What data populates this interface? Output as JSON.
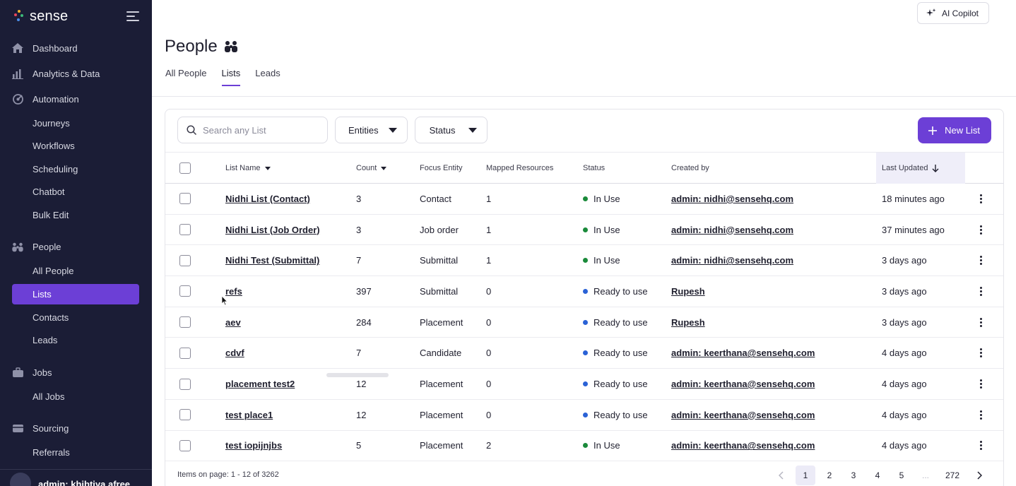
{
  "app": {
    "brand": "sense",
    "accent": "#6c3fd6",
    "sidebar_bg": "#1b1d36"
  },
  "sidebar": {
    "groups": [
      {
        "label": "Dashboard",
        "icon": "home-icon"
      },
      {
        "label": "Analytics & Data",
        "icon": "bar-chart-icon"
      },
      {
        "label": "Automation",
        "icon": "automation-icon",
        "items": [
          "Journeys",
          "Workflows",
          "Scheduling",
          "Chatbot",
          "Bulk Edit"
        ]
      },
      {
        "label": "People",
        "icon": "people-icon",
        "items": [
          "All People",
          "Lists",
          "Contacts",
          "Leads"
        ]
      },
      {
        "label": "Jobs",
        "icon": "briefcase-icon",
        "items": [
          "All Jobs"
        ]
      },
      {
        "label": "Sourcing",
        "icon": "sourcing-icon",
        "items": [
          "Referrals"
        ]
      }
    ],
    "user": "admin: khibtiya.afree"
  },
  "header": {
    "copilot_label": "AI Copilot",
    "title": "People",
    "tabs": [
      "All People",
      "Lists",
      "Leads"
    ],
    "active_tab": "Lists"
  },
  "toolbar": {
    "search_placeholder": "Search any List",
    "entities_label": "Entities",
    "status_label": "Status",
    "new_list_label": "New List"
  },
  "table": {
    "columns": [
      "List Name",
      "Count",
      "Focus Entity",
      "Mapped Resources",
      "Status",
      "Created by",
      "Last Updated"
    ],
    "sorted_column": "Last Updated",
    "rows": [
      {
        "name": "Nidhi List (Contact)",
        "count": "3",
        "entity": "Contact",
        "mapped": "1",
        "status": "In Use",
        "status_color": "#1a8a3a",
        "created_by": "admin: nidhi@sensehq.com",
        "updated": "18 minutes ago"
      },
      {
        "name": "Nidhi List (Job Order)",
        "count": "3",
        "entity": "Job order",
        "mapped": "1",
        "status": "In Use",
        "status_color": "#1a8a3a",
        "created_by": "admin: nidhi@sensehq.com",
        "updated": "37 minutes ago"
      },
      {
        "name": "Nidhi Test (Submittal)",
        "count": "7",
        "entity": "Submittal",
        "mapped": "1",
        "status": "In Use",
        "status_color": "#1a8a3a",
        "created_by": "admin: nidhi@sensehq.com",
        "updated": "3 days ago"
      },
      {
        "name": "refs",
        "count": "397",
        "entity": "Submittal",
        "mapped": "0",
        "status": "Ready to use",
        "status_color": "#2a62d6",
        "created_by": "Rupesh",
        "updated": "3 days ago"
      },
      {
        "name": "aev",
        "count": "284",
        "entity": "Placement",
        "mapped": "0",
        "status": "Ready to use",
        "status_color": "#2a62d6",
        "created_by": "Rupesh",
        "updated": "3 days ago"
      },
      {
        "name": "cdvf",
        "count": "7",
        "entity": "Candidate",
        "mapped": "0",
        "status": "Ready to use",
        "status_color": "#2a62d6",
        "created_by": "admin: keerthana@sensehq.com",
        "updated": "4 days ago"
      },
      {
        "name": "placement test2",
        "count": "12",
        "entity": "Placement",
        "mapped": "0",
        "status": "Ready to use",
        "status_color": "#2a62d6",
        "created_by": "admin: keerthana@sensehq.com",
        "updated": "4 days ago"
      },
      {
        "name": "test place1",
        "count": "12",
        "entity": "Placement",
        "mapped": "0",
        "status": "Ready to use",
        "status_color": "#2a62d6",
        "created_by": "admin: keerthana@sensehq.com",
        "updated": "4 days ago"
      },
      {
        "name": "test iopijnjbs",
        "count": "5",
        "entity": "Placement",
        "mapped": "2",
        "status": "In Use",
        "status_color": "#1a8a3a",
        "created_by": "admin: keerthana@sensehq.com",
        "updated": "4 days ago"
      }
    ]
  },
  "footer": {
    "items_text": "Items on page: 1 - 12 of 3262",
    "pages": [
      "1",
      "2",
      "3",
      "4",
      "5",
      "...",
      "272"
    ],
    "current_page": "1"
  }
}
